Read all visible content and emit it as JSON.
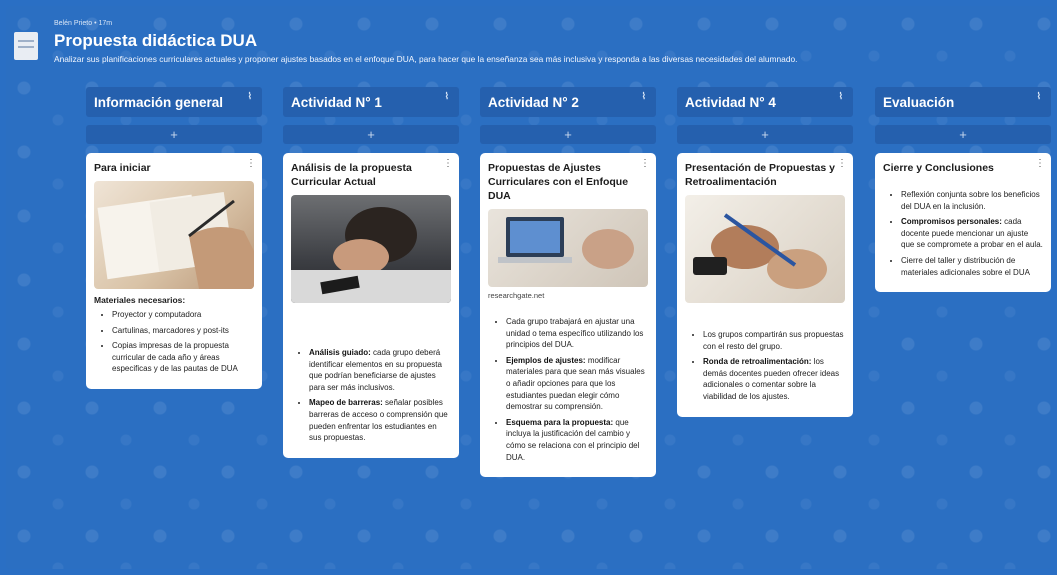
{
  "board": {
    "meta": "Belén Prieto • 17m",
    "title": "Propuesta didáctica DUA",
    "subtitle": "Analizar sus planificaciones curriculares actuales y proponer ajustes basados en el enfoque DUA, para hacer que la enseñanza sea más inclusiva y responda a las diversas necesidades del alumnado."
  },
  "add_label": "+",
  "col_menu_glyph": "⌇",
  "kebab_glyph": "⋮",
  "columns": [
    {
      "title": "Información general",
      "card": {
        "title": "Para iniciar",
        "heading": "Materiales necesarios:",
        "items": [
          {
            "bold": "",
            "text": "Proyector y computadora"
          },
          {
            "bold": "",
            "text": "Cartulinas, marcadores y post-its"
          },
          {
            "bold": "",
            "text": "Copias impresas de la propuesta curricular de cada año y áreas especificas y de las pautas de DUA"
          }
        ]
      }
    },
    {
      "title": "Actividad N° 1",
      "card": {
        "title": "Análisis de la propuesta Curricular Actual",
        "items": [
          {
            "bold": "Análisis guiado:",
            "text": " cada grupo deberá identificar elementos en su propuesta que podrían beneficiarse de ajustes para ser más inclusivos."
          },
          {
            "bold": "Mapeo de barreras:",
            "text": " señalar posibles barreras de acceso o comprensión que pueden enfrentar los estudiantes en sus propuestas."
          }
        ]
      }
    },
    {
      "title": "Actividad N° 2",
      "card": {
        "title": "Propuestas de Ajustes Curriculares con el Enfoque DUA",
        "caption": "researchgate.net",
        "items": [
          {
            "bold": "",
            "text": "Cada grupo trabajará en ajustar una unidad o tema específico utilizando los principios del DUA."
          },
          {
            "bold": "Ejemplos de ajustes:",
            "text": " modificar materiales para que sean más visuales o añadir opciones para que los estudiantes puedan elegir cómo demostrar su comprensión."
          },
          {
            "bold": "Esquema para la propuesta:",
            "text": " que incluya la justificación del cambio y cómo se relaciona con el principio del DUA."
          }
        ]
      }
    },
    {
      "title": "Actividad N° 4",
      "card": {
        "title": "Presentación de Propuestas y Retroalimentación",
        "items": [
          {
            "bold": "",
            "text": "Los grupos compartirán sus propuestas con el resto del grupo."
          },
          {
            "bold": "Ronda de retroalimentación:",
            "text": " los demás docentes pueden ofrecer ideas adicionales o comentar sobre la viabilidad de los ajustes."
          }
        ]
      }
    },
    {
      "title": "Evaluación",
      "card": {
        "title": "Cierre y Conclusiones",
        "items": [
          {
            "bold": "",
            "text": "Reflexión conjunta sobre los beneficios del DUA en la inclusión."
          },
          {
            "bold": "Compromisos personales:",
            "text": " cada docente puede mencionar un ajuste que se compromete a probar en el aula."
          },
          {
            "bold": "",
            "text": "Cierre del taller y distribución de materiales adicionales sobre el DUA"
          }
        ]
      }
    }
  ]
}
